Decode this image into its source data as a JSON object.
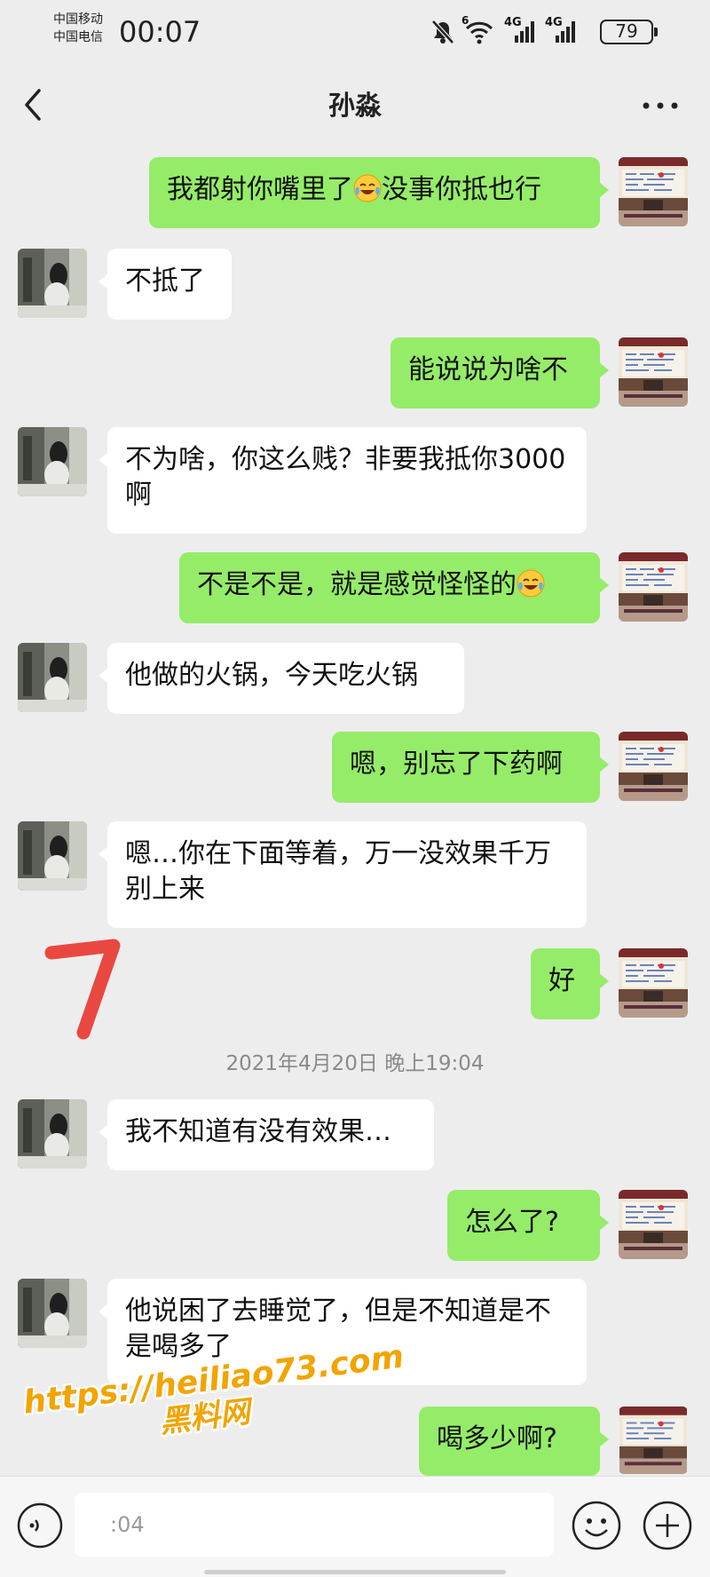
{
  "status_bar": {
    "carrier_1": "中国移动",
    "carrier_2": "中国电信",
    "time": "00:07",
    "battery": "79",
    "signal_1_label": "4G",
    "signal_2_label": "4G",
    "wifi_label": "6"
  },
  "nav": {
    "title": "孙淼"
  },
  "messages": [
    {
      "from": "me",
      "text": "我都射你嘴里了",
      "emoji": "laughing-crying-emoji",
      "text_after": "没事你抵也行"
    },
    {
      "from": "them",
      "text": "不抵了"
    },
    {
      "from": "me",
      "text": "能说说为啥不"
    },
    {
      "from": "them",
      "text": "不为啥，你这么贱？非要我抵你3000 啊"
    },
    {
      "from": "me",
      "text": "不是不是，就是感觉怪怪的",
      "emoji": "laughing-crying-emoji"
    },
    {
      "from": "them",
      "text": "他做的火锅，今天吃火锅"
    },
    {
      "from": "me",
      "text": "嗯，别忘了下药啊"
    },
    {
      "from": "them",
      "text": "嗯…你在下面等着，万一没效果千万别上来"
    },
    {
      "from": "me",
      "text": "好"
    },
    {
      "timestamp": "2021年4月20日 晚上19:04"
    },
    {
      "from": "them",
      "text": "我不知道有没有效果…"
    },
    {
      "from": "me",
      "text": "怎么了?"
    },
    {
      "from": "them",
      "text": "他说困了去睡觉了，但是不知道是不是喝多了"
    },
    {
      "from": "me",
      "text": "喝多少啊?"
    }
  ],
  "input_bar": {
    "text": ":04"
  },
  "watermark": {
    "url": "https://heiliao73.com",
    "name": "黑料网"
  },
  "colors": {
    "outgoing_bubble": "#95ec69",
    "incoming_bubble": "#ffffff",
    "background": "#ededed",
    "watermark": "#f2a400",
    "annotation": "#e8352d"
  }
}
